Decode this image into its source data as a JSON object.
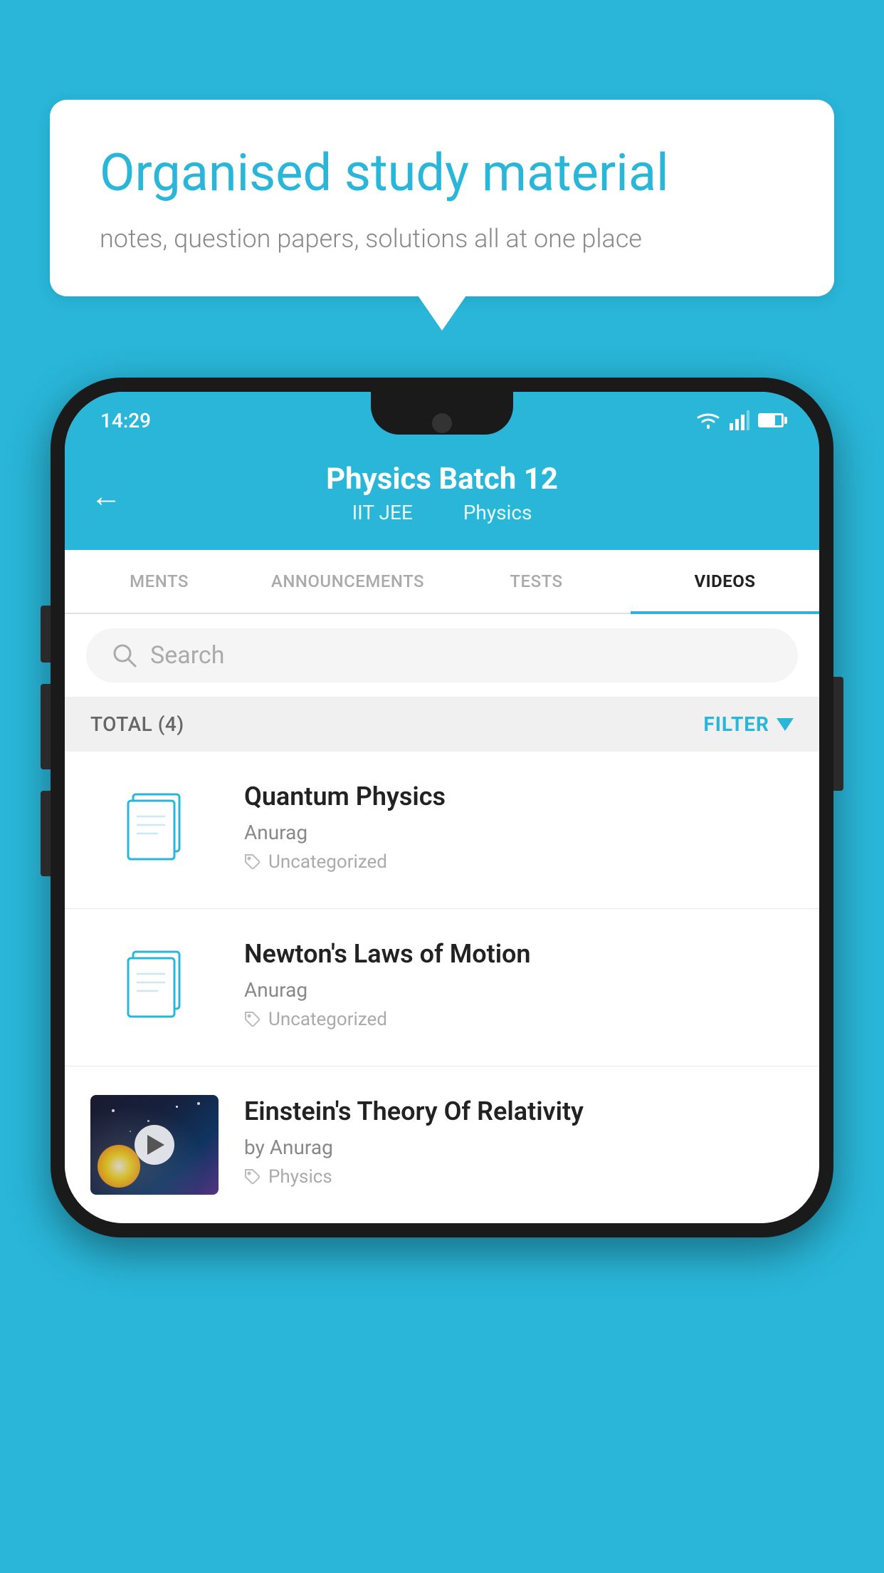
{
  "background_color": "#29b6d8",
  "speech_bubble": {
    "title": "Organised study material",
    "subtitle": "notes, question papers, solutions all at one place"
  },
  "phone": {
    "status_bar": {
      "time": "14:29"
    },
    "header": {
      "title": "Physics Batch 12",
      "subtitle_left": "IIT JEE",
      "subtitle_right": "Physics",
      "back_label": "←"
    },
    "tabs": [
      {
        "label": "MENTS",
        "active": false
      },
      {
        "label": "ANNOUNCEMENTS",
        "active": false
      },
      {
        "label": "TESTS",
        "active": false
      },
      {
        "label": "VIDEOS",
        "active": true
      }
    ],
    "search": {
      "placeholder": "Search"
    },
    "filter_row": {
      "total": "TOTAL (4)",
      "filter_label": "FILTER"
    },
    "videos": [
      {
        "title": "Quantum Physics",
        "author": "Anurag",
        "tag": "Uncategorized",
        "has_thumb": false
      },
      {
        "title": "Newton's Laws of Motion",
        "author": "Anurag",
        "tag": "Uncategorized",
        "has_thumb": false
      },
      {
        "title": "Einstein's Theory Of Relativity",
        "author": "by Anurag",
        "tag": "Physics",
        "has_thumb": true
      }
    ]
  }
}
